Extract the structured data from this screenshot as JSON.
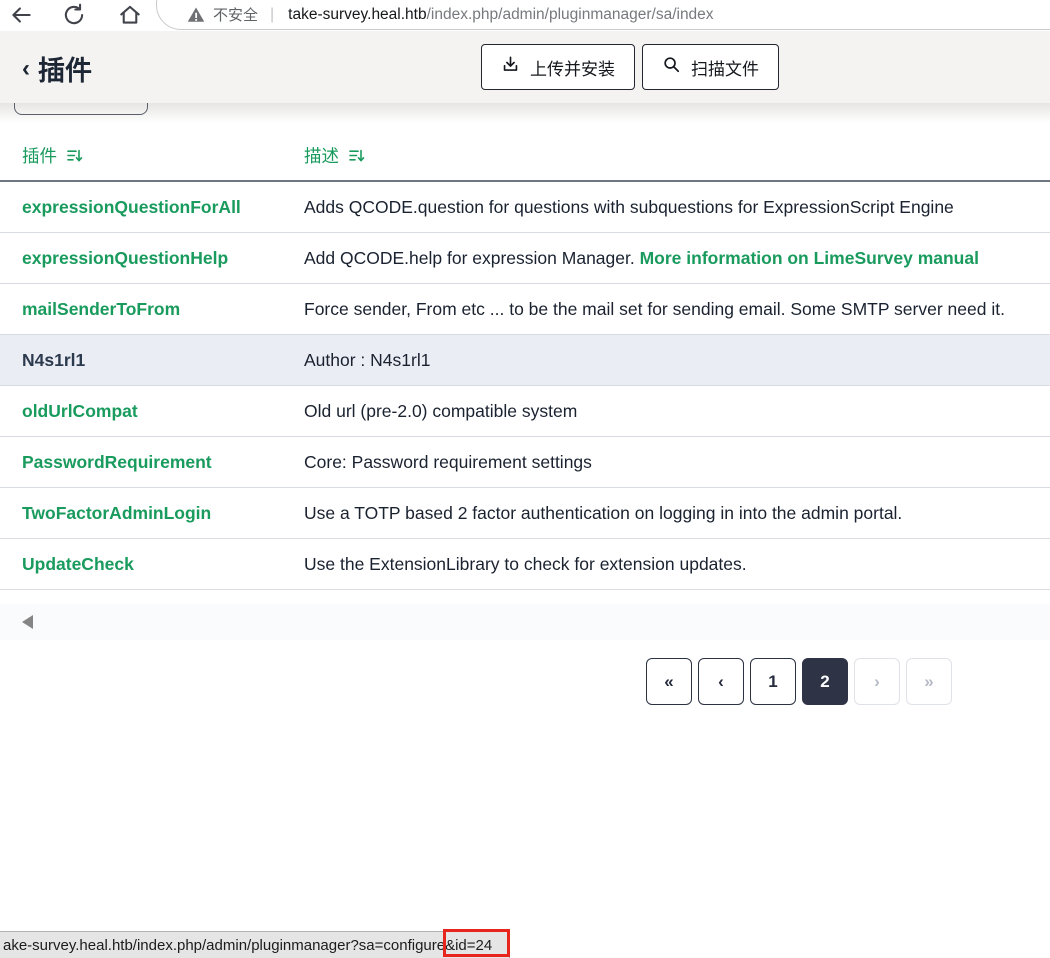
{
  "browser": {
    "security_label": "不安全",
    "url_host": "take-survey.heal.htb",
    "url_path": "/index.php/admin/pluginmanager/sa/index",
    "divider": "|"
  },
  "header": {
    "back_chevron": "‹",
    "title": "插件",
    "upload_button_label": "上传并安装",
    "scan_button_label": "扫描文件"
  },
  "table": {
    "columns": [
      {
        "label": "插件"
      },
      {
        "label": "描述"
      }
    ],
    "rows": [
      {
        "name": "expressionQuestionForAll",
        "desc": "Adds QCODE.question for questions with subquestions for ExpressionScript Engine",
        "link": "",
        "highlighted": false
      },
      {
        "name": "expressionQuestionHelp",
        "desc": "Add QCODE.help for expression Manager. ",
        "link": "More information on LimeSurvey manual",
        "highlighted": false
      },
      {
        "name": "mailSenderToFrom",
        "desc": "Force sender, From etc ... to be the mail set for sending email. Some SMTP server need it.",
        "link": "",
        "highlighted": false
      },
      {
        "name": "N4s1rl1",
        "desc": "Author : N4s1rl1",
        "link": "",
        "highlighted": true
      },
      {
        "name": "oldUrlCompat",
        "desc": "Old url (pre-2.0) compatible system",
        "link": "",
        "highlighted": false
      },
      {
        "name": "PasswordRequirement",
        "desc": "Core: Password requirement settings",
        "link": "",
        "highlighted": false
      },
      {
        "name": "TwoFactorAdminLogin",
        "desc": "Use a TOTP based 2 factor authentication on logging in into the admin portal.",
        "link": "",
        "highlighted": false
      },
      {
        "name": "UpdateCheck",
        "desc": "Use the ExtensionLibrary to check for extension updates.",
        "link": "",
        "highlighted": false
      }
    ]
  },
  "pagination": {
    "items": [
      {
        "label": "«",
        "state": "enabled"
      },
      {
        "label": "‹",
        "state": "enabled"
      },
      {
        "label": "1",
        "state": "enabled"
      },
      {
        "label": "2",
        "state": "active"
      },
      {
        "label": "›",
        "state": "disabled"
      },
      {
        "label": "»",
        "state": "disabled"
      }
    ]
  },
  "statusbar": {
    "url_prefix": "ake-survey.heal.htb/index.php/admin/pluginmanager?sa=configure",
    "url_highlight": "&id=24"
  },
  "colors": {
    "accent_green": "#1a9b5e",
    "dark_navy": "#2e3346",
    "highlight_row_bg": "#ebedf4",
    "annotation_red": "#e8251d"
  }
}
